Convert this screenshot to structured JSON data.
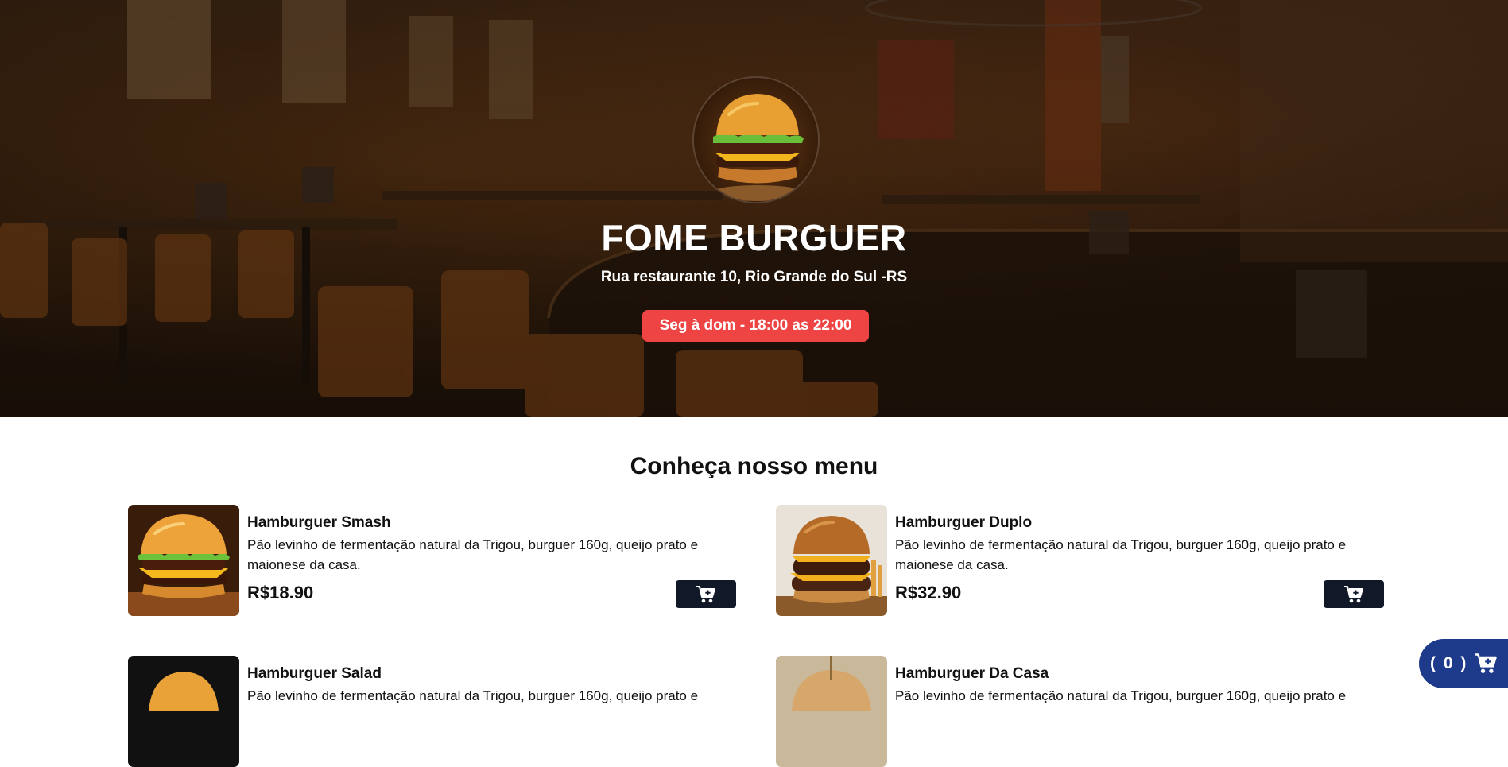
{
  "hero": {
    "title": "FOME BURGUER",
    "address": "Rua restaurante 10, Rio Grande do Sul -RS",
    "hours": "Seg à dom - 18:00 as 22:00",
    "logo_icon": "burger-logo"
  },
  "menu": {
    "heading": "Conheça nosso menu",
    "items": [
      {
        "name": "Hamburguer Smash",
        "description": "Pão levinho de fermentação natural da Trigou, burguer 160g, queijo prato e maionese da casa.",
        "price": "R$18.90",
        "icon": "cart-plus-icon"
      },
      {
        "name": "Hamburguer Duplo",
        "description": "Pão levinho de fermentação natural da Trigou, burguer 160g, queijo prato e maionese da casa.",
        "price": "R$32.90",
        "icon": "cart-plus-icon"
      },
      {
        "name": "Hamburguer Salad",
        "description": "Pão levinho de fermentação natural da Trigou, burguer 160g, queijo prato e"
      },
      {
        "name": "Hamburguer Da Casa",
        "description": "Pão levinho de fermentação natural da Trigou, burguer 160g, queijo prato e"
      }
    ]
  },
  "cart": {
    "count_label": "( 0 )",
    "icon": "shopping-cart-icon"
  },
  "colors": {
    "badge": "#ef4444",
    "button": "#111827",
    "cart": "#1e3a8a"
  }
}
